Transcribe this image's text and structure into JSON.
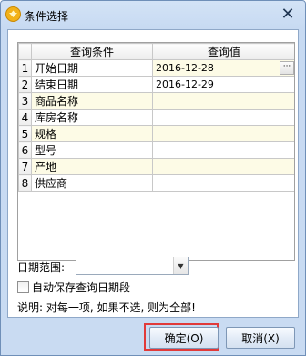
{
  "window": {
    "title": "条件选择",
    "close_glyph": "✕"
  },
  "grid": {
    "headers": [
      "查询条件",
      "查询值"
    ],
    "rows": [
      {
        "idx": "1",
        "condition": "开始日期",
        "value": "2016-12-28"
      },
      {
        "idx": "2",
        "condition": "结束日期",
        "value": "2016-12-29"
      },
      {
        "idx": "3",
        "condition": "商品名称",
        "value": ""
      },
      {
        "idx": "4",
        "condition": "库房名称",
        "value": ""
      },
      {
        "idx": "5",
        "condition": "规格",
        "value": ""
      },
      {
        "idx": "6",
        "condition": "型号",
        "value": ""
      },
      {
        "idx": "7",
        "condition": "产地",
        "value": ""
      },
      {
        "idx": "8",
        "condition": "供应商",
        "value": ""
      }
    ],
    "ellipsis_label": "···"
  },
  "date_range": {
    "label": "日期范围:",
    "value": ""
  },
  "autosave": {
    "label": "自动保存查询日期段",
    "checked": false
  },
  "hint": "说明: 对每一项, 如果不选, 则为全部!",
  "buttons": {
    "ok": "确定(O)",
    "cancel": "取消(X)"
  },
  "colors": {
    "highlight": "#e13a3a",
    "odd_row": "#fdfbe6"
  }
}
